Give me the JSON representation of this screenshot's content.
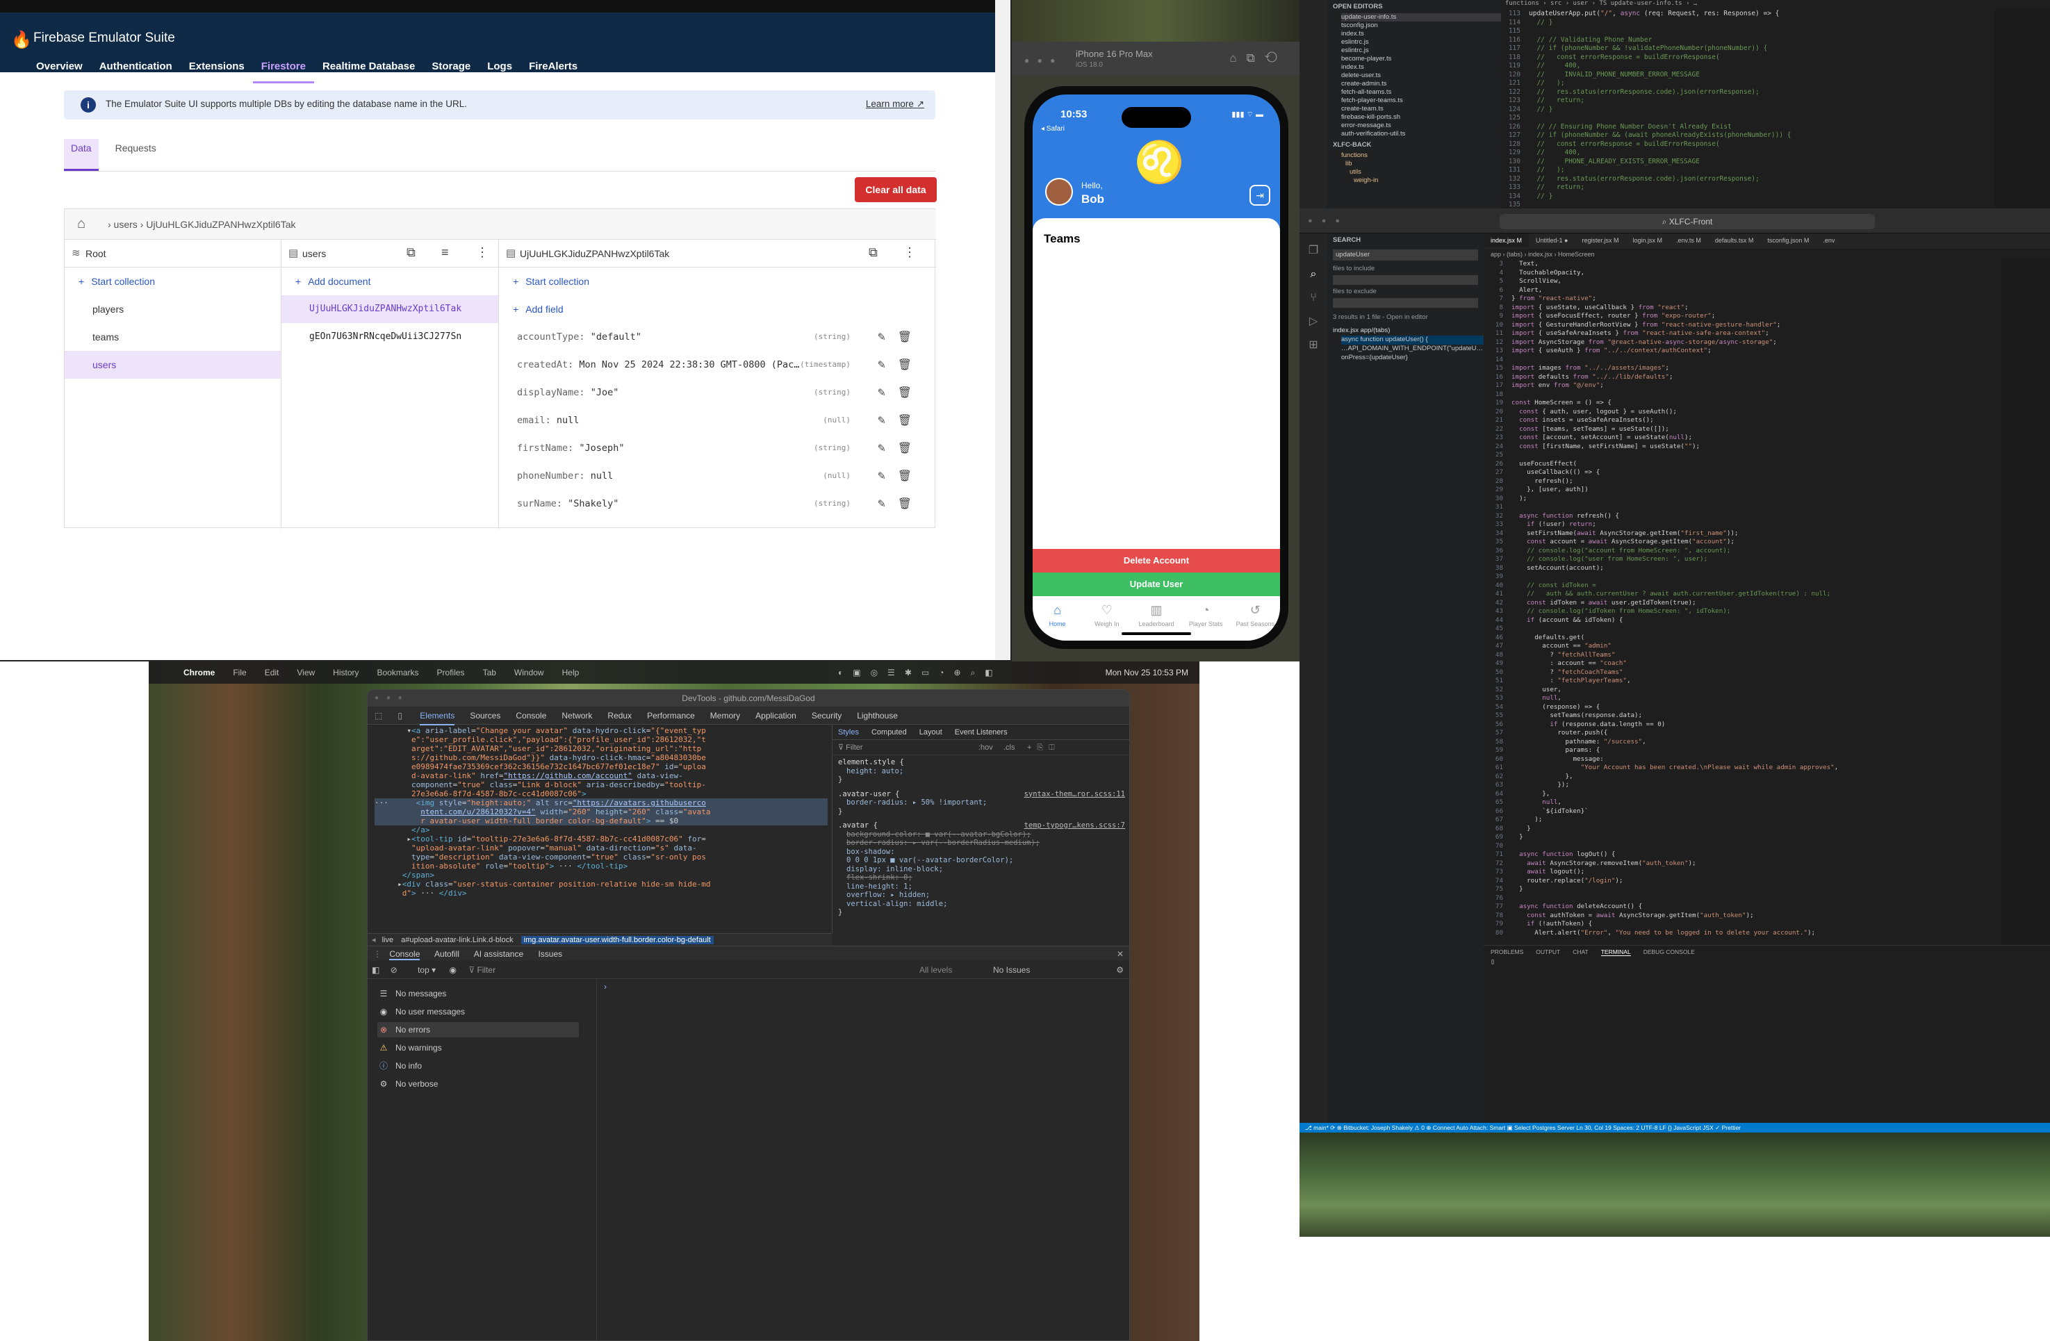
{
  "firebase": {
    "app_title": "Firebase Emulator Suite",
    "nav_tabs": [
      "Overview",
      "Authentication",
      "Extensions",
      "Firestore",
      "Realtime Database",
      "Storage",
      "Logs",
      "FireAlerts"
    ],
    "active_tab": "Firestore",
    "info_text": "The Emulator Suite UI supports multiple DBs by editing the database name in the URL.",
    "learn_more": "Learn more",
    "sub_tabs": [
      "Data",
      "Requests"
    ],
    "clear_button": "Clear all data",
    "breadcrumb": "› users › UjUuHLGKJiduZPANHwzXptil6Tak",
    "root_label": "Root",
    "start_collection": "Start collection",
    "collections": [
      "players",
      "teams",
      "users"
    ],
    "users_label": "users",
    "add_document": "Add document",
    "documents": [
      "UjUuHLGKJiduZPANHwzXptil6Tak",
      "gEOn7U63NrRNcqeDwUii3CJ277Sn"
    ],
    "doc_id": "UjUuHLGKJiduZPANHwzXptil6Tak",
    "add_field": "Add field",
    "fields": [
      {
        "key": "accountType:",
        "value": "\"default\"",
        "type": "(string)"
      },
      {
        "key": "createdAt:",
        "value": "Mon Nov 25 2024 22:38:30 GMT-0800 (Pac…",
        "type": "(timestamp)"
      },
      {
        "key": "displayName:",
        "value": "\"Joe\"",
        "type": "(string)"
      },
      {
        "key": "email:",
        "value": "null",
        "type": "(null)"
      },
      {
        "key": "firstName:",
        "value": "\"Joseph\"",
        "type": "(string)"
      },
      {
        "key": "phoneNumber:",
        "value": "null",
        "type": "(null)"
      },
      {
        "key": "surName:",
        "value": "\"Shakely\"",
        "type": "(string)"
      }
    ]
  },
  "simulator": {
    "device": "iPhone 16 Pro Max",
    "os": "iOS 18.0",
    "time": "10:53",
    "back_label": "◂ Safari",
    "hello": "Hello,",
    "name": "Bob",
    "section": "Teams",
    "delete_button": "Delete Account",
    "update_button": "Update User",
    "tabs": [
      "Home",
      "Weigh In",
      "Leaderboard",
      "Player Stats",
      "Past Seasons"
    ]
  },
  "vscode_top": {
    "breadcrumb": "functions › src › user › TS update-user-info.ts › …",
    "open_editors": "OPEN EDITORS",
    "files": [
      "update-user-info.ts",
      "tsconfig.json",
      "index.ts",
      "eslintrc.js",
      "eslintrc.js",
      "become-player.ts",
      "index.ts",
      "delete-user.ts",
      "create-admin.ts",
      "fetch-all-teams.ts",
      "fetch-player-teams.ts",
      "create-team.ts",
      "firebase-kill-ports.sh",
      "error-message.ts",
      "auth-verification-util.ts"
    ],
    "xlfc": "XLFC-BACK",
    "tree": [
      "functions",
      "lib",
      "utils",
      "weigh-in"
    ],
    "code": [
      {
        "n": "113",
        "t": "updateUserApp.put(\"/\", async (req: Request, res: Response) => {"
      },
      {
        "n": "114",
        "t": "  // }"
      },
      {
        "n": "115",
        "t": ""
      },
      {
        "n": "116",
        "t": "  // // Validating Phone Number"
      },
      {
        "n": "117",
        "t": "  // if (phoneNumber && !validatePhoneNumber(phoneNumber)) {"
      },
      {
        "n": "118",
        "t": "  //   const errorResponse = buildErrorResponse("
      },
      {
        "n": "119",
        "t": "  //     400,"
      },
      {
        "n": "120",
        "t": "  //     INVALID_PHONE_NUMBER_ERROR_MESSAGE"
      },
      {
        "n": "121",
        "t": "  //   );"
      },
      {
        "n": "122",
        "t": "  //   res.status(errorResponse.code).json(errorResponse);"
      },
      {
        "n": "123",
        "t": "  //   return;"
      },
      {
        "n": "124",
        "t": "  // }"
      },
      {
        "n": "125",
        "t": ""
      },
      {
        "n": "126",
        "t": "  // // Ensuring Phone Number Doesn't Already Exist"
      },
      {
        "n": "127",
        "t": "  // if (phoneNumber && (await phoneAlreadyExists(phoneNumber))) {"
      },
      {
        "n": "128",
        "t": "  //   const errorResponse = buildErrorResponse("
      },
      {
        "n": "129",
        "t": "  //     400,"
      },
      {
        "n": "130",
        "t": "  //     PHONE_ALREADY_EXISTS_ERROR_MESSAGE"
      },
      {
        "n": "131",
        "t": "  //   );"
      },
      {
        "n": "132",
        "t": "  //   res.status(errorResponse.code).json(errorResponse);"
      },
      {
        "n": "133",
        "t": "  //   return;"
      },
      {
        "n": "134",
        "t": "  // }"
      },
      {
        "n": "135",
        "t": ""
      }
    ]
  },
  "vscode_main": {
    "search": "XLFC-Front",
    "search_panel": "SEARCH",
    "search_term": "updateUser",
    "files_include": "files to include",
    "files_exclude": "files to exclude",
    "results": "3 results in 1 file - Open in editor",
    "result_file": "index.jsx  app/(tabs)",
    "result_lines": [
      "async function updateUser() {",
      "…API_DOMAIN_WITH_ENDPOINT(\"updateU…",
      "onPress={updateUser}"
    ],
    "tabs": [
      "index.jsx M",
      "Untitled-1 ●",
      "register.jsx M",
      "login.jsx M",
      ".env.ts M",
      "defaults.tsx M",
      "tsconfig.json M",
      ".env"
    ],
    "crumb": "app › (tabs) › index.jsx › HomeScreen",
    "code": [
      {
        "n": "3",
        "t": "  Text,"
      },
      {
        "n": "4",
        "t": "  TouchableOpacity,"
      },
      {
        "n": "5",
        "t": "  ScrollView,"
      },
      {
        "n": "6",
        "t": "  Alert,"
      },
      {
        "n": "7",
        "t": "} from \"react-native\";"
      },
      {
        "n": "8",
        "t": "import { useState, useCallback } from \"react\";"
      },
      {
        "n": "9",
        "t": "import { useFocusEffect, router } from \"expo-router\";"
      },
      {
        "n": "10",
        "t": "import { GestureHandlerRootView } from \"react-native-gesture-handler\";"
      },
      {
        "n": "11",
        "t": "import { useSafeAreaInsets } from \"react-native-safe-area-context\";"
      },
      {
        "n": "12",
        "t": "import AsyncStorage from \"@react-native-async-storage/async-storage\";"
      },
      {
        "n": "13",
        "t": "import { useAuth } from \"../../context/authContext\";"
      },
      {
        "n": "14",
        "t": ""
      },
      {
        "n": "15",
        "t": "import images from \"../../assets/images\";"
      },
      {
        "n": "16",
        "t": "import defaults from \"../../lib/defaults\";"
      },
      {
        "n": "17",
        "t": "import env from \"@/env\";"
      },
      {
        "n": "18",
        "t": ""
      },
      {
        "n": "19",
        "t": "const HomeScreen = () => {"
      },
      {
        "n": "20",
        "t": "  const { auth, user, logout } = useAuth();"
      },
      {
        "n": "21",
        "t": "  const insets = useSafeAreaInsets();"
      },
      {
        "n": "22",
        "t": "  const [teams, setTeams] = useState([]);"
      },
      {
        "n": "23",
        "t": "  const [account, setAccount] = useState(null);"
      },
      {
        "n": "24",
        "t": "  const [firstName, setFirstName] = useState(\"\");"
      },
      {
        "n": "25",
        "t": ""
      },
      {
        "n": "26",
        "t": "  useFocusEffect("
      },
      {
        "n": "27",
        "t": "    useCallback(() => {"
      },
      {
        "n": "28",
        "t": "      refresh();"
      },
      {
        "n": "29",
        "t": "    }, [user, auth])"
      },
      {
        "n": "30",
        "t": "  );"
      },
      {
        "n": "31",
        "t": ""
      },
      {
        "n": "32",
        "t": "  async function refresh() {"
      },
      {
        "n": "33",
        "t": "    if (!user) return;"
      },
      {
        "n": "34",
        "t": "    setFirstName(await AsyncStorage.getItem(\"first_name\"));"
      },
      {
        "n": "35",
        "t": "    const account = await AsyncStorage.getItem(\"account\");"
      },
      {
        "n": "36",
        "t": "    // console.log(\"account from HomeScreen: \", account);"
      },
      {
        "n": "37",
        "t": "    // console.log(\"user from HomeScreen: \", user);"
      },
      {
        "n": "38",
        "t": "    setAccount(account);"
      },
      {
        "n": "39",
        "t": ""
      },
      {
        "n": "40",
        "t": "    // const idToken ="
      },
      {
        "n": "41",
        "t": "    //   auth && auth.currentUser ? await auth.currentUser.getIdToken(true) : null;"
      },
      {
        "n": "42",
        "t": "    const idToken = await user.getIdToken(true);"
      },
      {
        "n": "43",
        "t": "    // console.log(\"idToken from HomeScreen: \", idToken);"
      },
      {
        "n": "44",
        "t": "    if (account && idToken) {"
      },
      {
        "n": "45",
        "t": ""
      },
      {
        "n": "46",
        "t": "      defaults.get("
      },
      {
        "n": "47",
        "t": "        account == \"admin\""
      },
      {
        "n": "48",
        "t": "          ? \"fetchAllTeams\""
      },
      {
        "n": "49",
        "t": "          : account == \"coach\""
      },
      {
        "n": "50",
        "t": "          ? \"fetchCoachTeams\""
      },
      {
        "n": "51",
        "t": "          : \"fetchPlayerTeams\","
      },
      {
        "n": "52",
        "t": "        user,"
      },
      {
        "n": "53",
        "t": "        null,"
      },
      {
        "n": "54",
        "t": "        (response) => {"
      },
      {
        "n": "55",
        "t": "          setTeams(response.data);"
      },
      {
        "n": "56",
        "t": "          if (response.data.length == 0)"
      },
      {
        "n": "57",
        "t": "            router.push({"
      },
      {
        "n": "58",
        "t": "              pathname: \"/success\","
      },
      {
        "n": "59",
        "t": "              params: {"
      },
      {
        "n": "60",
        "t": "                message:"
      },
      {
        "n": "61",
        "t": "                  \"Your Account has been created.\\nPlease wait while admin approves\","
      },
      {
        "n": "62",
        "t": "              },"
      },
      {
        "n": "63",
        "t": "            });"
      },
      {
        "n": "64",
        "t": "        },"
      },
      {
        "n": "65",
        "t": "        null,"
      },
      {
        "n": "66",
        "t": "        `${idToken}`"
      },
      {
        "n": "67",
        "t": "      );"
      },
      {
        "n": "68",
        "t": "    }"
      },
      {
        "n": "69",
        "t": "  }"
      },
      {
        "n": "70",
        "t": ""
      },
      {
        "n": "71",
        "t": "  async function logOut() {"
      },
      {
        "n": "72",
        "t": "    await AsyncStorage.removeItem(\"auth_token\");"
      },
      {
        "n": "73",
        "t": "    await logout();"
      },
      {
        "n": "74",
        "t": "    router.replace(\"/login\");"
      },
      {
        "n": "75",
        "t": "  }"
      },
      {
        "n": "76",
        "t": ""
      },
      {
        "n": "77",
        "t": "  async function deleteAccount() {"
      },
      {
        "n": "78",
        "t": "    const authToken = await AsyncStorage.getItem(\"auth_token\");"
      },
      {
        "n": "79",
        "t": "    if (!authToken) {"
      },
      {
        "n": "80",
        "t": "      Alert.alert(\"Error\", \"You need to be logged in to delete your account.\");"
      }
    ],
    "panel_tabs": [
      "PROBLEMS",
      "OUTPUT",
      "CHAT",
      "TERMINAL",
      "DEBUG CONSOLE"
    ],
    "status": "⎇ main* ⟳  ⊗ Bitbucket: Joseph Shakely  ⚠ 0  ⊕ Connect  Auto Attach: Smart  ▣ Select Postgres Server                                  Ln 30, Col 19   Spaces: 2   UTF-8   LF   {} JavaScript JSX   ✓ Prettier"
  },
  "mac": {
    "menu": [
      "Chrome",
      "File",
      "Edit",
      "View",
      "History",
      "Bookmarks",
      "Profiles",
      "Tab",
      "Window",
      "Help"
    ],
    "clock": "Mon Nov 25  10:53 PM"
  },
  "devtools": {
    "title": "DevTools - github.com/MessiDaGod",
    "tabs": [
      "Elements",
      "Sources",
      "Console",
      "Network",
      "Redux",
      "Performance",
      "Memory",
      "Application",
      "Security",
      "Lighthouse"
    ],
    "style_tabs": [
      "Styles",
      "Computed",
      "Layout",
      "Event Listeners"
    ],
    "filter": "Filter",
    "hov": ":hov",
    "cls": ".cls",
    "crumb_items": [
      "live",
      "a#upload-avatar-link.Link.d-block",
      "img.avatar.avatar-user.width-full.border.color-bg-default"
    ],
    "drawer_tabs": [
      "Console",
      "Autofill",
      "AI assistance",
      "Issues"
    ],
    "context": "top",
    "console_filter": "Filter",
    "levels": "All levels",
    "issues": "No Issues",
    "messages": [
      "No messages",
      "No user messages",
      "No errors",
      "No warnings",
      "No info",
      "No verbose"
    ],
    "styles": [
      {
        "sel": "element.style {",
        "rules": [
          "height: auto;"
        ],
        "src": ""
      },
      {
        "sel": ".avatar-user {",
        "rules": [
          "border-radius: ▸ 50% !important;"
        ],
        "src": "syntax-them…ror.scss:11"
      },
      {
        "sel": ".avatar {",
        "rules": [
          "background-color: ■ var(--avatar-bgColor);",
          "border-radius: ▸ var(--borderRadius-medium);",
          "box-shadow:",
          "  0 0 0 1px ■ var(--avatar-borderColor);",
          "display: inline-block;",
          "flex-shrink: 0;",
          "line-height: 1;",
          "overflow: ▸ hidden;",
          "vertical-align: middle;"
        ],
        "src": "temp-typogr…kens.scss:7"
      }
    ]
  }
}
